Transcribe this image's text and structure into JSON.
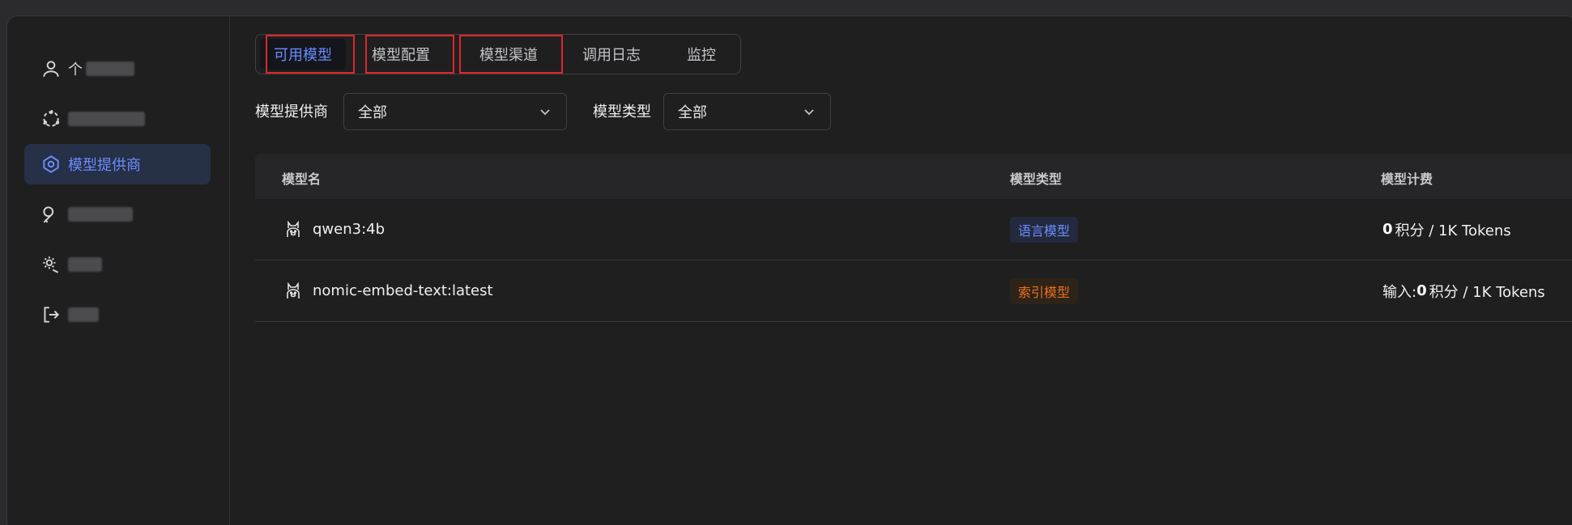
{
  "sidebar": {
    "items": [
      {
        "label": "个"
      },
      {
        "label": ""
      },
      {
        "label": "模型提供商"
      },
      {
        "label": ""
      },
      {
        "label": ""
      },
      {
        "label": ""
      }
    ]
  },
  "tabs": [
    {
      "label": "可用模型",
      "active": true
    },
    {
      "label": "模型配置"
    },
    {
      "label": "模型渠道"
    },
    {
      "label": "调用日志"
    },
    {
      "label": "监控"
    }
  ],
  "filters": {
    "provider_label": "模型提供商",
    "provider_value": "全部",
    "type_label": "模型类型",
    "type_value": "全部"
  },
  "table": {
    "headers": [
      "模型名",
      "模型类型",
      "模型计费"
    ],
    "rows": [
      {
        "name": "qwen3:4b",
        "type": "语言模型",
        "price_prefix": "",
        "price_value": "0",
        "price_unit": "积分 / 1K Tokens"
      },
      {
        "name": "nomic-embed-text:latest",
        "type": "索引模型",
        "price_prefix": "输入:",
        "price_value": "0",
        "price_unit": "积分 / 1K Tokens"
      }
    ]
  },
  "colors": {
    "accent": "#6b8cff",
    "orange": "#ea6f1c",
    "highlight_box": "#e0262b"
  }
}
